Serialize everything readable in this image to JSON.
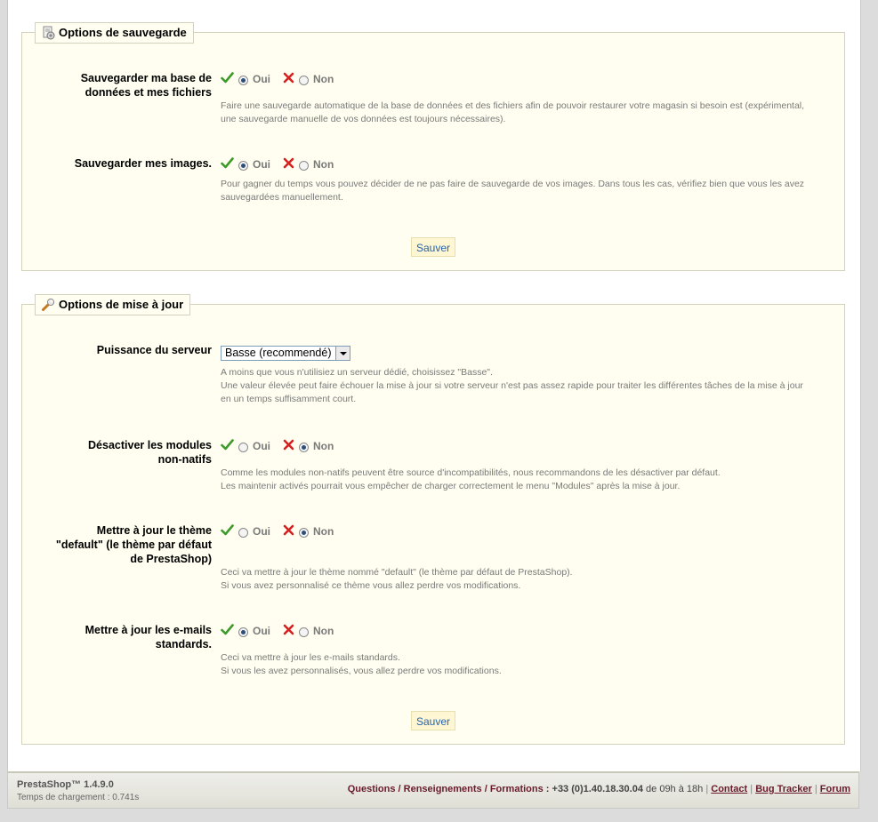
{
  "backup": {
    "legend": "Options de sauvegarde",
    "rows": [
      {
        "label_lines": [
          "Sauvegarder ma base de",
          "données et mes fichiers"
        ],
        "yes_label": "Oui",
        "no_label": "Non",
        "selected": "yes",
        "desc_lines": [
          "Faire une sauvegarde automatique de la base de données et des fichiers afin de pouvoir restaurer votre magasin si besoin est (expérimental,",
          "une sauvegarde manuelle de vos données est toujours nécessaires)."
        ]
      },
      {
        "label_lines": [
          "Sauvegarder mes images."
        ],
        "yes_label": "Oui",
        "no_label": "Non",
        "selected": "yes",
        "desc_lines": [
          "Pour gagner du temps vous pouvez décider de ne pas faire de sauvegarde de vos images. Dans tous les cas, vérifiez bien que vous les avez",
          "sauvegardées manuellement."
        ]
      }
    ],
    "save_label": "Sauver"
  },
  "update": {
    "legend": "Options de mise à jour",
    "server": {
      "label_lines": [
        "Puissance du serveur"
      ],
      "selected_value": "Basse (recommendé)",
      "desc_lines": [
        "A moins que vous n'utilisiez un serveur dédié, choisissez \"Basse\".",
        "Une valeur élevée peut faire échouer la mise à jour si votre serveur n'est pas assez rapide pour traiter les différentes tâches de la mise à jour",
        "en un temps suffisamment court."
      ]
    },
    "rows": [
      {
        "label_lines": [
          "Désactiver les modules",
          "non-natifs"
        ],
        "yes_label": "Oui",
        "no_label": "Non",
        "selected": "no",
        "desc_lines": [
          "Comme les modules non-natifs peuvent être source d'incompatibilités, nous recommandons de les désactiver par défaut.",
          "Les maintenir activés pourrait vous empêcher de charger correctement le menu \"Modules\" après la mise à jour."
        ]
      },
      {
        "label_lines": [
          "Mettre à jour le thème",
          "\"default\" (le thème par défaut",
          "de PrestaShop)"
        ],
        "yes_label": "Oui",
        "no_label": "Non",
        "selected": "no",
        "desc_lines": [
          "Ceci va mettre à jour le thème nommé \"default\" (le thème par défaut de PrestaShop).",
          "Si vous avez personnalisé ce thème vous allez perdre vos modifications."
        ]
      },
      {
        "label_lines": [
          "Mettre à jour les e-mails",
          "standards."
        ],
        "yes_label": "Oui",
        "no_label": "Non",
        "selected": "yes",
        "desc_lines": [
          "Ceci va mettre à jour les e-mails standards.",
          "Si vous les avez personnalisés, vous allez perdre vos modifications."
        ]
      }
    ],
    "save_label": "Sauver"
  },
  "footer": {
    "version": "PrestaShop™ 1.4.9.0",
    "load_time": "Temps de chargement : 0.741s",
    "contact_label": "Questions / Renseignements / Formations :",
    "phone": "+33 (0)1.40.18.30.04",
    "hours": "de 09h à 18h",
    "links": [
      "Contact",
      "Bug Tracker",
      "Forum"
    ]
  },
  "colors": {
    "check": "#3d9a2a",
    "cross": "#d62020",
    "link": "#6a1b2b",
    "button_text": "#2764a8"
  },
  "icons": {
    "backup_legend": "database-backup-icon",
    "update_legend": "wrench-icon",
    "yes": "check-icon",
    "no": "cross-icon"
  }
}
